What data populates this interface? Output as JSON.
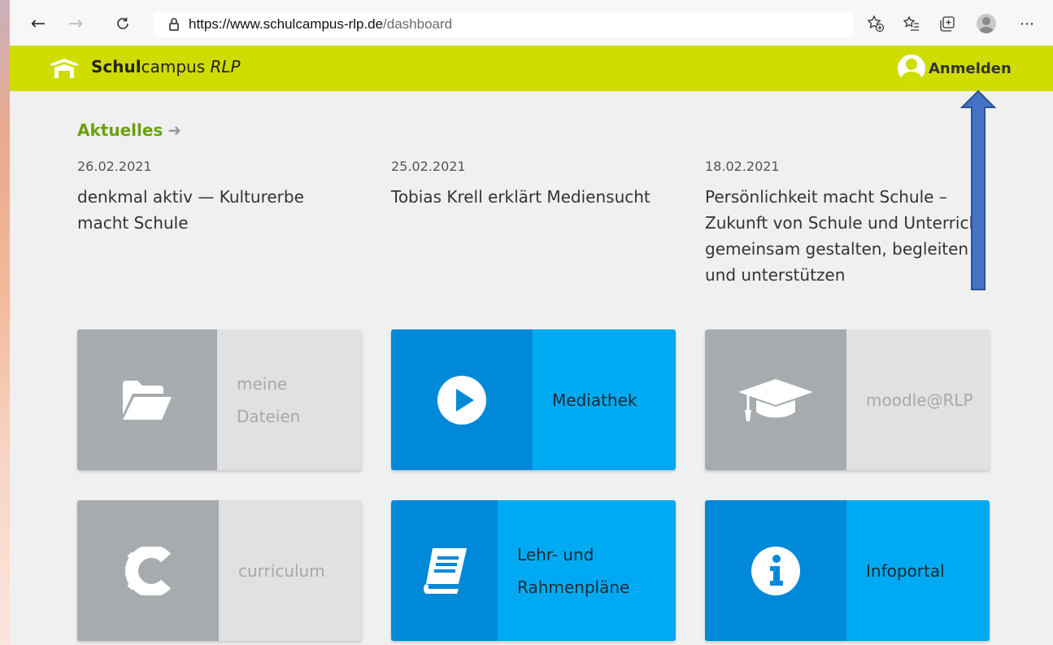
{
  "browser": {
    "url_domain": "https://www.schulcampus-rlp.de",
    "url_path": "/dashboard",
    "icons": [
      "back-arrow-icon",
      "forward-arrow-icon",
      "refresh-icon",
      "lock-icon",
      "add-favorite-icon",
      "favorites-icon",
      "collections-icon",
      "profile-icon",
      "more-icon"
    ]
  },
  "header": {
    "brand_bold": "Schul",
    "brand_regular": "campus",
    "brand_italic": "RLP",
    "login_label": "Anmelden",
    "bg_color": "#cfdc00"
  },
  "news": {
    "heading": "Aktuelles",
    "items": [
      {
        "date": "26.02.2021",
        "title": "denkmal aktiv — Kulturerbe macht Schule"
      },
      {
        "date": "25.02.2021",
        "title": "Tobias Krell erklärt Mediensucht"
      },
      {
        "date": "18.02.2021",
        "title": "Persönlichkeit macht Schule – Zukunft von Schule und Unterricht gemeinsam gestalten, begleiten und unterstützen"
      }
    ]
  },
  "tiles": [
    {
      "label_line1": "meine",
      "label_line2": "Dateien",
      "icon": "folder-open-icon",
      "style": "grey"
    },
    {
      "label": "Mediathek",
      "icon": "play-circle-icon",
      "style": "blue"
    },
    {
      "label": "moodle@RLP",
      "icon": "graduation-cap-icon",
      "style": "grey"
    },
    {
      "label": "curriculum",
      "icon": "gear-c-icon",
      "style": "grey"
    },
    {
      "label_line1": "Lehr- und",
      "label_line2": "Rahmenpläne",
      "icon": "book-icon",
      "style": "blue"
    },
    {
      "label": "Infoportal",
      "icon": "info-circle-icon",
      "style": "blue"
    }
  ],
  "colors": {
    "accent_green": "#6aa10c",
    "tile_blue_dark": "#0089d9",
    "tile_blue_light": "#00aaf2",
    "tile_grey_dark": "#a6abae",
    "tile_grey_light": "#e1e1e3"
  }
}
